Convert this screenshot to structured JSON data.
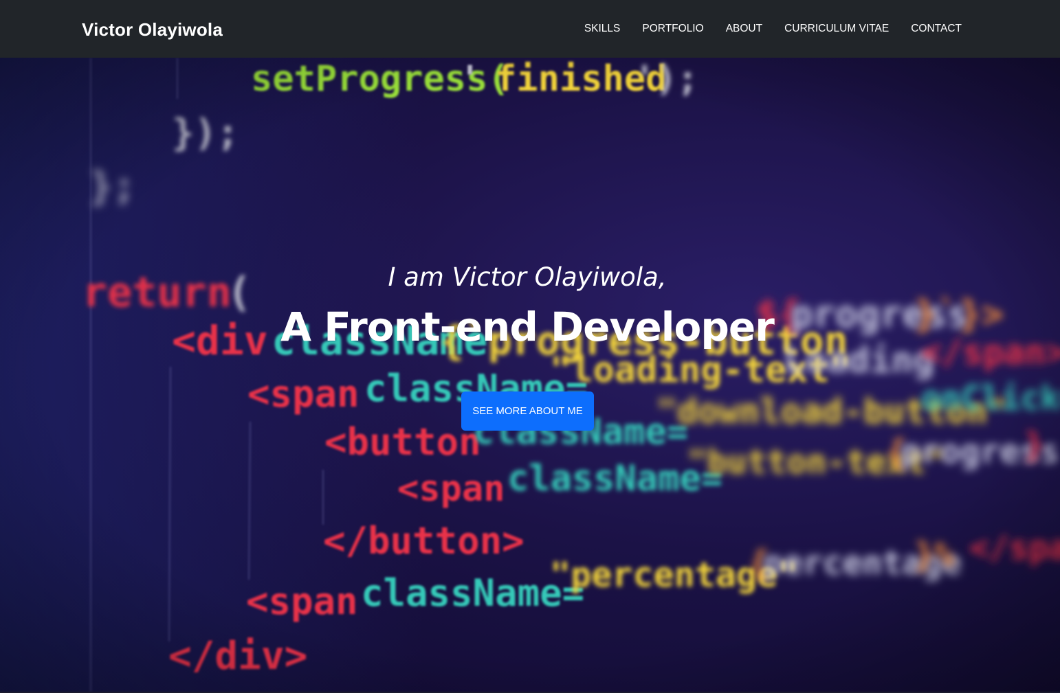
{
  "navbar": {
    "brand": "Victor Olayiwola",
    "links": [
      {
        "label": "SKILLS"
      },
      {
        "label": "PORTFOLIO"
      },
      {
        "label": "ABOUT"
      },
      {
        "label": "CURRICULUM VITAE"
      },
      {
        "label": "CONTACT"
      }
    ]
  },
  "hero": {
    "intro": "I am Victor Olayiwola,",
    "title": "A Front-end Developer",
    "button_label": "SEE MORE ABOUT ME",
    "background_code_text": [
      "setProgress('finished');",
      "});",
      "};",
      "return (",
      "<div className={progress-button",
      "<span className=\"loading-text\">Loading</span>",
      "<button className=\"download-button\"",
      "<span className=\"button-text\">{progress}",
      "</button>",
      "<span className=\"percentage\">{percentage}%</span>",
      "</div>"
    ]
  },
  "colors": {
    "navbar_bg": "#212529",
    "hero_bg": "#1b1246",
    "button_bg": "#0d6efd",
    "code_green": "#9be33a",
    "code_red": "#e8334a",
    "code_teal": "#34c8b8",
    "code_yellow": "#f4d53a",
    "code_white": "#d8d8e8"
  }
}
